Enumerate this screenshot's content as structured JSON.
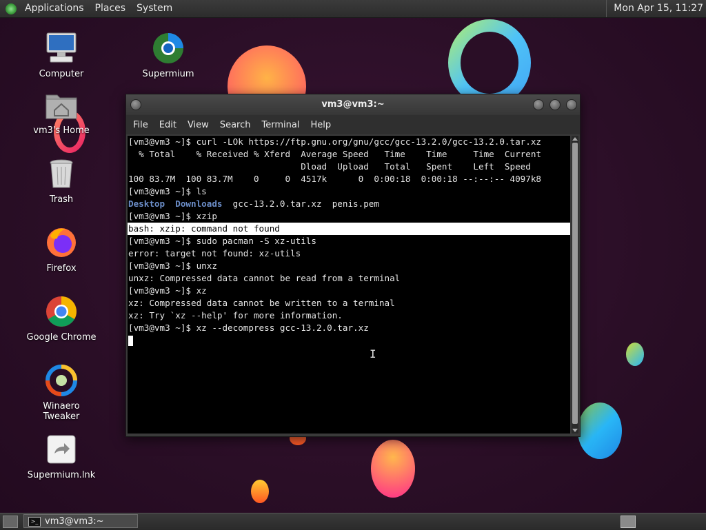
{
  "top_panel": {
    "menus": [
      "Applications",
      "Places",
      "System"
    ],
    "clock": "Mon Apr 15, 11:27"
  },
  "desktop": {
    "icons": [
      {
        "label": "Computer",
        "icon": "computer-icon"
      },
      {
        "label": "Supermium",
        "icon": "supermium-icon"
      },
      {
        "label": "vm3's Home",
        "icon": "home-folder-icon"
      },
      {
        "label": "Trash",
        "icon": "trash-icon"
      },
      {
        "label": "Firefox",
        "icon": "firefox-icon"
      },
      {
        "label": "Google Chrome",
        "icon": "chrome-icon"
      },
      {
        "label": "Winaero Tweaker",
        "icon": "winaero-icon"
      },
      {
        "label": "Supermium.lnk",
        "icon": "shortcut-icon"
      }
    ]
  },
  "window": {
    "title": "vm3@vm3:~",
    "menus": [
      "File",
      "Edit",
      "View",
      "Search",
      "Terminal",
      "Help"
    ]
  },
  "terminal": {
    "lines": [
      "[vm3@vm3 ~]$ curl -LOk https://ftp.gnu.org/gnu/gcc/gcc-13.2.0/gcc-13.2.0.tar.xz",
      "  % Total    % Received % Xferd  Average Speed   Time    Time     Time  Current",
      "                                 Dload  Upload   Total   Spent    Left  Speed",
      "100 83.7M  100 83.7M    0     0  4517k      0  0:00:18  0:00:18 --:--:-- 4097k8",
      "[vm3@vm3 ~]$ ls",
      "",
      "[vm3@vm3 ~]$ xzip",
      "bash: xzip: command not found",
      "[vm3@vm3 ~]$ sudo pacman -S xz-utils",
      "error: target not found: xz-utils",
      "[vm3@vm3 ~]$ unxz",
      "unxz: Compressed data cannot be read from a terminal",
      "[vm3@vm3 ~]$ xz",
      "xz: Compressed data cannot be written to a terminal",
      "xz: Try `xz --help' for more information.",
      "[vm3@vm3 ~]$ xz --decompress gcc-13.2.0.tar.xz"
    ],
    "ls_output": {
      "dir1": "Desktop",
      "dir2": "Downloads",
      "files": "  gcc-13.2.0.tar.xz  penis.pem"
    }
  },
  "taskbar": {
    "task_label": "vm3@vm3:~"
  }
}
